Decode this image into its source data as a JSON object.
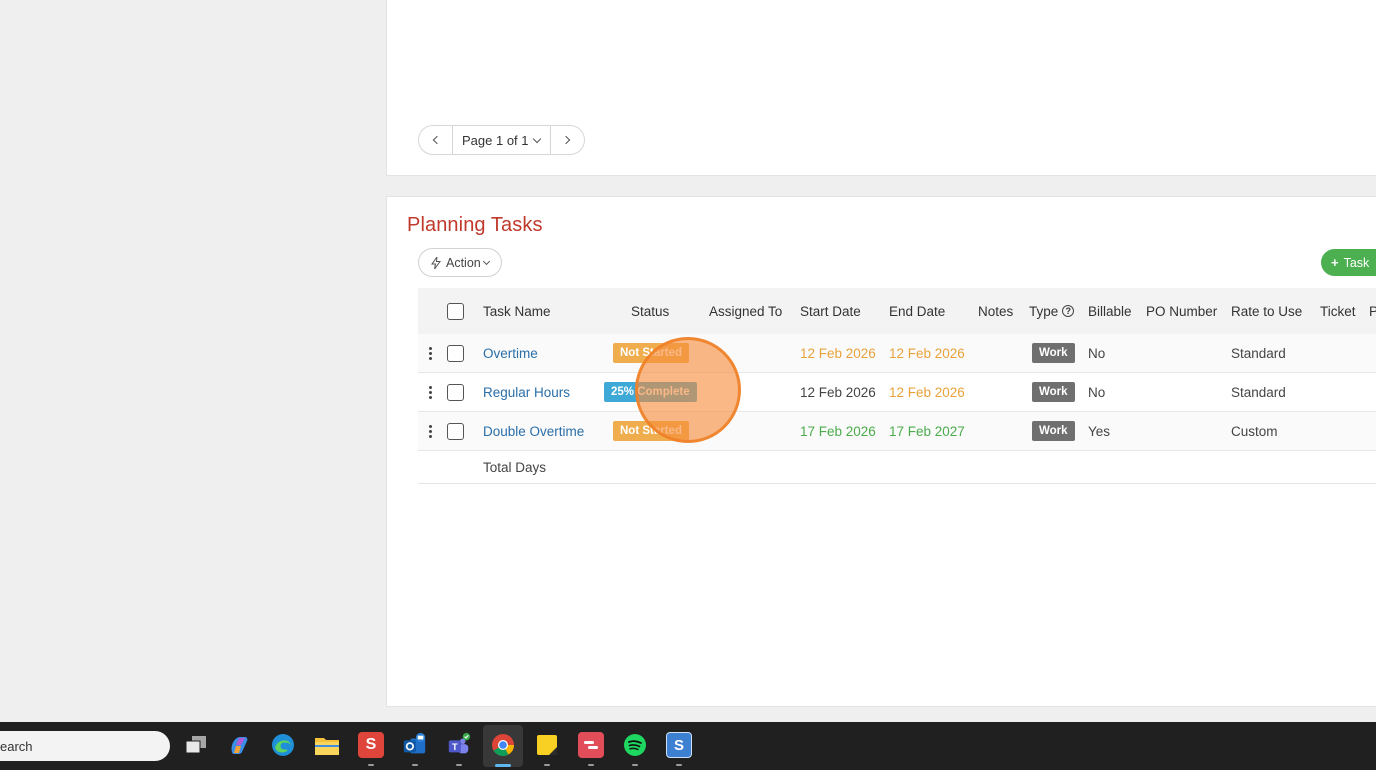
{
  "pager": {
    "prev_icon": "chevron-left-icon",
    "label": "Page 1 of 1",
    "next_icon": "chevron-right-icon"
  },
  "section": {
    "title": "Planning Tasks",
    "action_label": "Action",
    "task_label": "Task"
  },
  "columns": {
    "task_name": "Task Name",
    "status": "Status",
    "assigned_to": "Assigned To",
    "start_date": "Start Date",
    "end_date": "End Date",
    "notes": "Notes",
    "type": "Type",
    "billable": "Billable",
    "po_number": "PO Number",
    "rate": "Rate to Use",
    "ticket": "Ticket",
    "extra": "P"
  },
  "rows": [
    {
      "name": "Overtime",
      "status": "Not Started",
      "status_color": "#f0ad4e",
      "start": "12 Feb 2026",
      "start_color": "#e9a23b",
      "end": "12 Feb 2026",
      "end_color": "#e9a23b",
      "type": "Work",
      "billable": "No",
      "rate": "Standard"
    },
    {
      "name": "Regular Hours",
      "status": "25% Complete",
      "status_color": "#3ea9d6",
      "start": "12 Feb 2026",
      "start_color": "#444444",
      "end": "12 Feb 2026",
      "end_color": "#e9a23b",
      "type": "Work",
      "billable": "No",
      "rate": "Standard"
    },
    {
      "name": "Double Overtime",
      "status": "Not Started",
      "status_color": "#f0ad4e",
      "start": "17 Feb 2026",
      "start_color": "#4bab4b",
      "end": "17 Feb 2027",
      "end_color": "#4bab4b",
      "type": "Work",
      "billable": "Yes",
      "rate": "Custom"
    }
  ],
  "total_label": "Total Days",
  "taskbar": {
    "search_placeholder": "earch",
    "icons": [
      "task-view-icon",
      "copilot-icon",
      "edge-icon",
      "file-explorer-icon",
      "wps-office-icon",
      "outlook-icon",
      "teams-icon",
      "chrome-icon",
      "sticky-notes-icon",
      "app-red-icon",
      "spotify-icon",
      "app-s-icon"
    ],
    "s_letter": "S"
  }
}
